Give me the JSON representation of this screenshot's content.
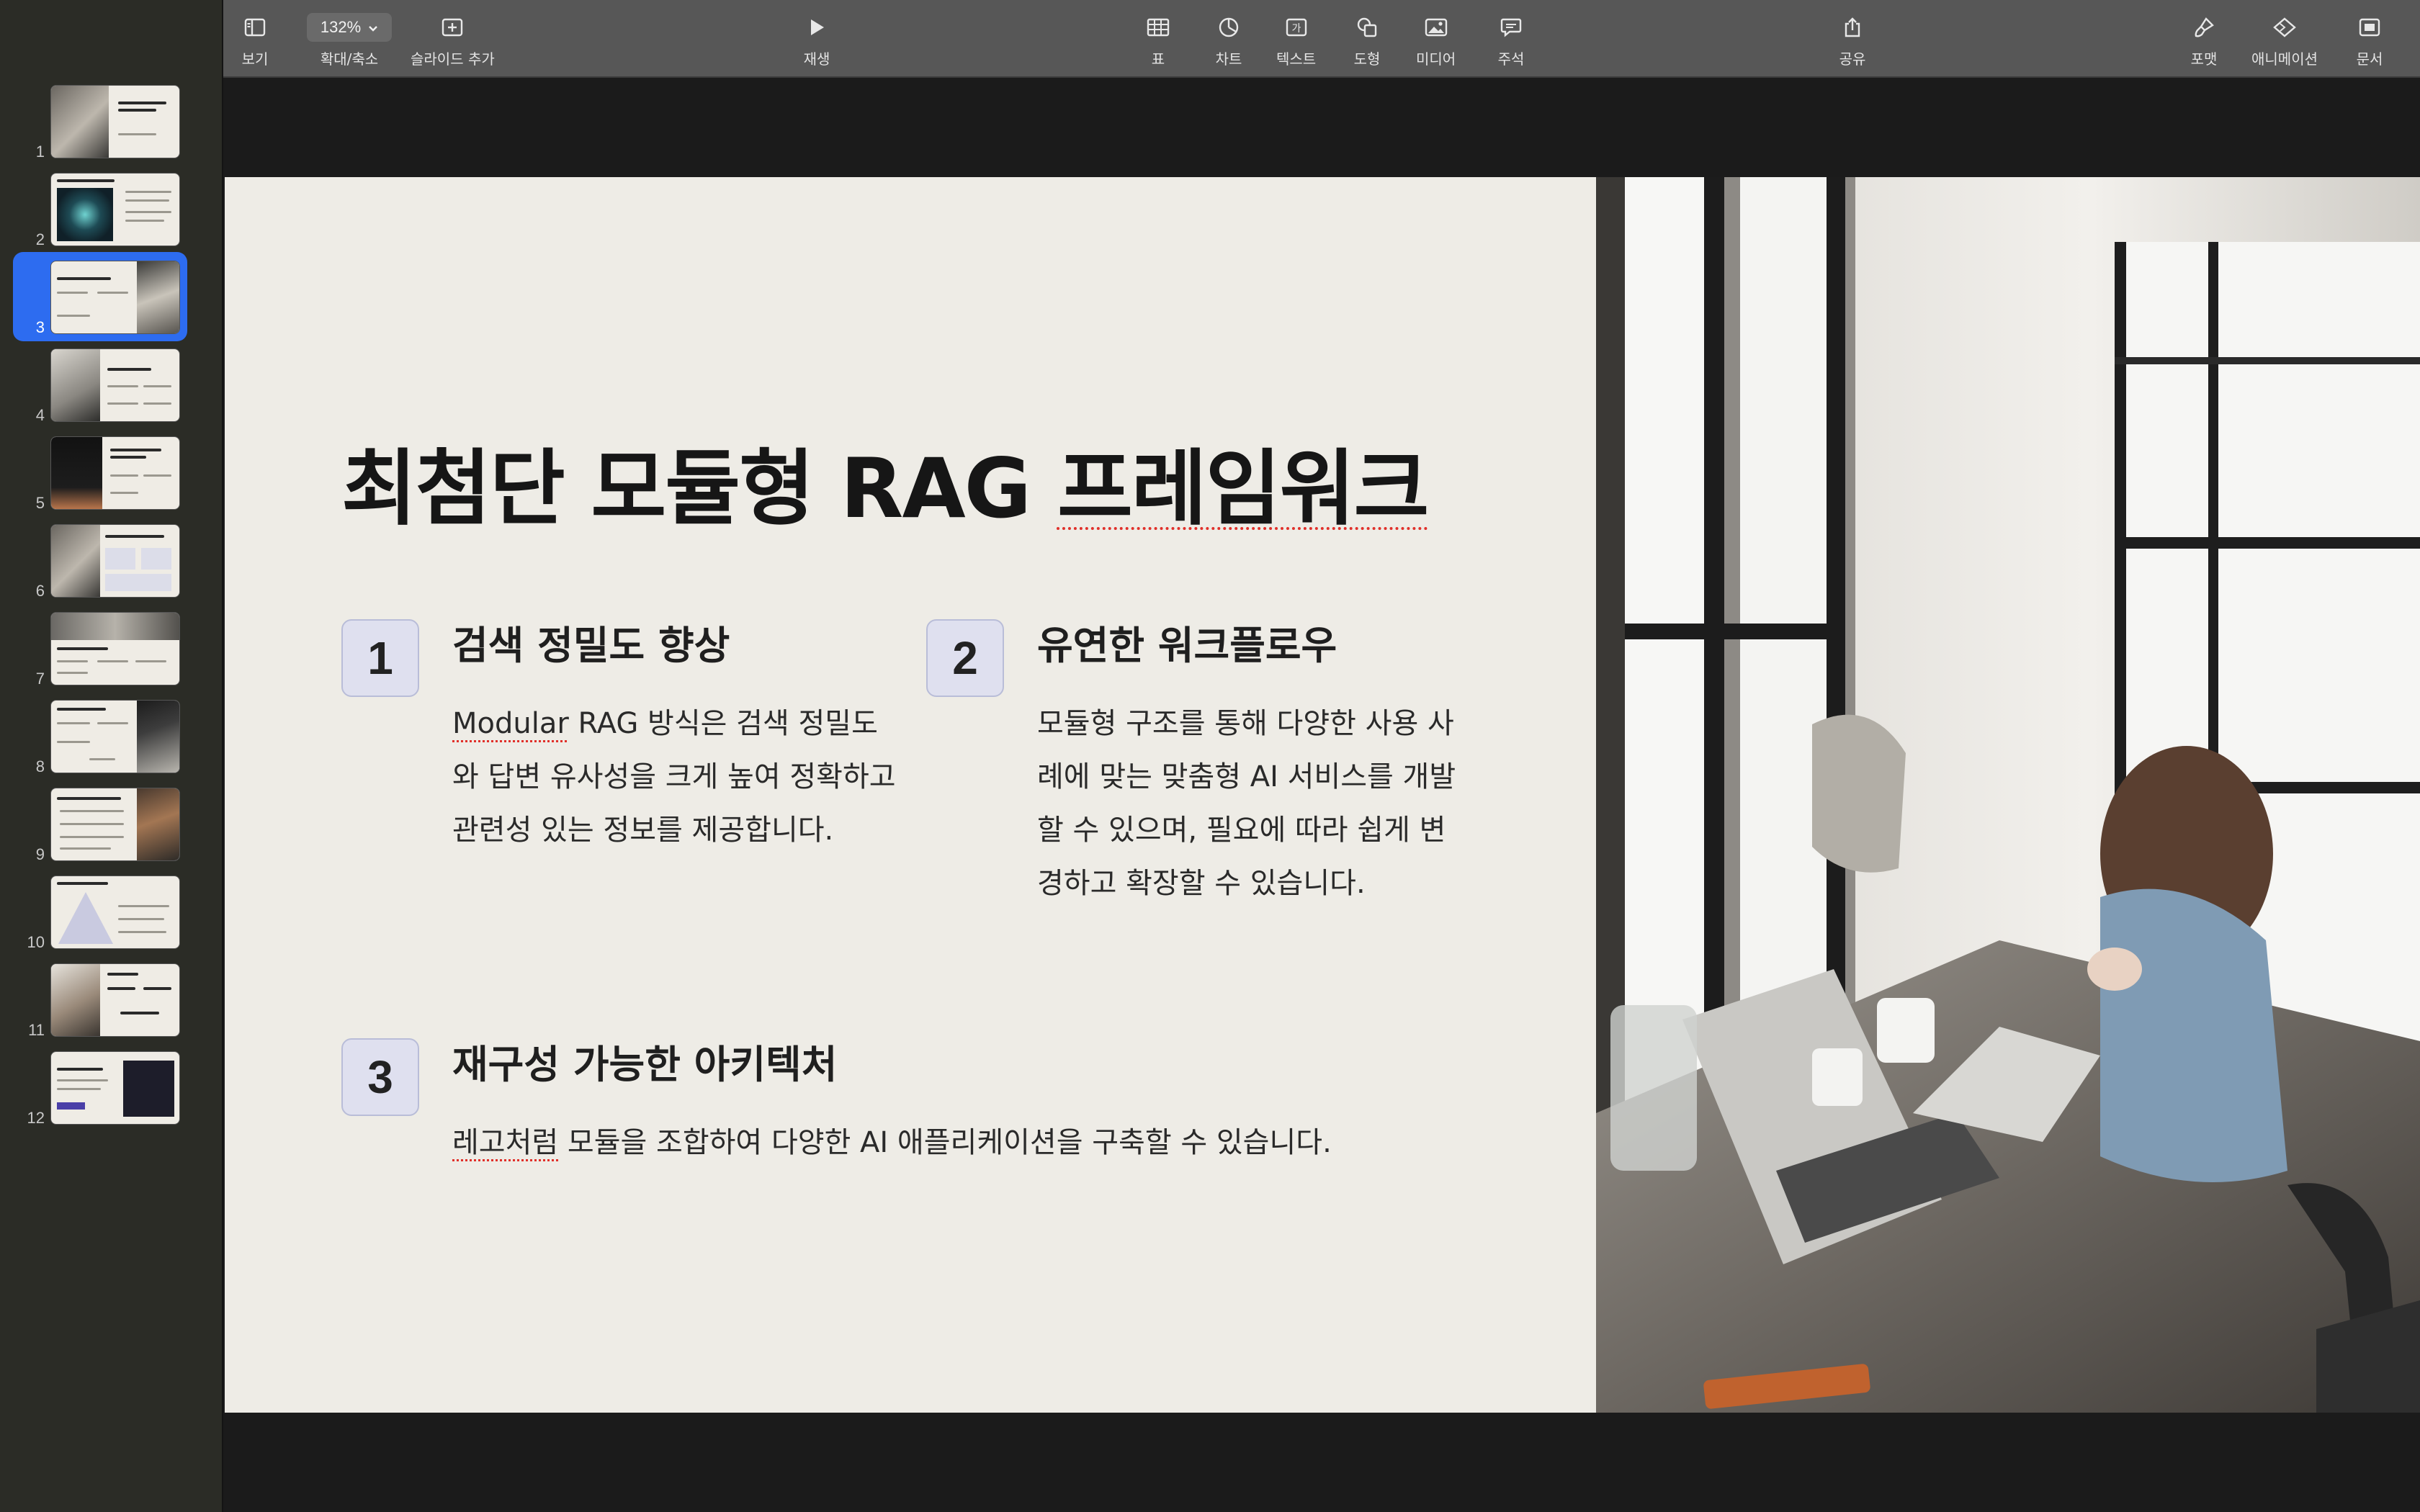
{
  "toolbar": {
    "view": "보기",
    "zoom_value": "132%",
    "zoom_label": "확대/축소",
    "add_slide": "슬라이드 추가",
    "play": "재생",
    "table": "표",
    "chart": "차트",
    "text": "텍스트",
    "shape": "도형",
    "media": "미디어",
    "comment": "주석",
    "share": "공유",
    "format": "포맷",
    "animate": "애니메이션",
    "document": "문서"
  },
  "sidebar": {
    "selected_index": 3,
    "slides": [
      "1",
      "2",
      "3",
      "4",
      "5",
      "6",
      "7",
      "8",
      "9",
      "10",
      "11",
      "12"
    ]
  },
  "slide": {
    "title_part1": "최첨단 모듈형 RAG ",
    "title_part2": "프레임워크",
    "features": [
      {
        "num": "1",
        "title": "검색 정밀도 향상",
        "body_prefix": "Modular",
        "body": " RAG 방식은 검색 정밀도와 답변 유사성을 크게 높여 정확하고 관련성 있는 정보를 제공합니다."
      },
      {
        "num": "2",
        "title": "유연한 워크플로우",
        "body": "모듈형 구조를 통해 다양한 사용 사례에 맞는 맞춤형 AI 서비스를 개발할 수 있으며, 필요에 따라 쉽게 변경하고 확장할 수 있습니다."
      },
      {
        "num": "3",
        "title": "재구성 가능한 아키텍처",
        "body_prefix": "레고처럼",
        "body": " 모듈을 조합하여 다양한 AI 애플리케이션을 구축할 수 있습니다."
      }
    ]
  },
  "colors": {
    "accent": "#2d6cf0",
    "slide_bg": "#eeece6",
    "badge_bg": "#dfe0ef",
    "toolbar_bg": "#575757"
  }
}
